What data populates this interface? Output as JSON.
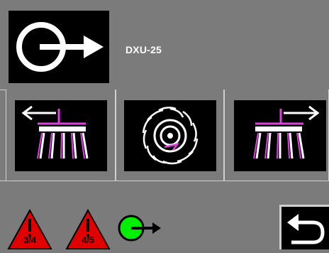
{
  "header": {
    "device_label": "DXU-25",
    "icon": "output-arrow-icon"
  },
  "functions": [
    {
      "icon": "broom-left-icon"
    },
    {
      "icon": "rotor-icon"
    },
    {
      "icon": "broom-right-icon"
    }
  ],
  "warnings": [
    {
      "label": "3/4",
      "icon": "warning-triangle-icon",
      "color": "#e00000"
    },
    {
      "label": "4/5",
      "icon": "warning-triangle-icon",
      "color": "#e00000"
    }
  ],
  "status": {
    "icon": "active-output-icon",
    "color": "#00ee00"
  },
  "back": {
    "icon": "back-arrow-icon"
  },
  "colors": {
    "background": "#7b7b7b",
    "tile": "#000000",
    "accent": "#e040e0",
    "warning": "#e00000",
    "active": "#00ee00"
  }
}
